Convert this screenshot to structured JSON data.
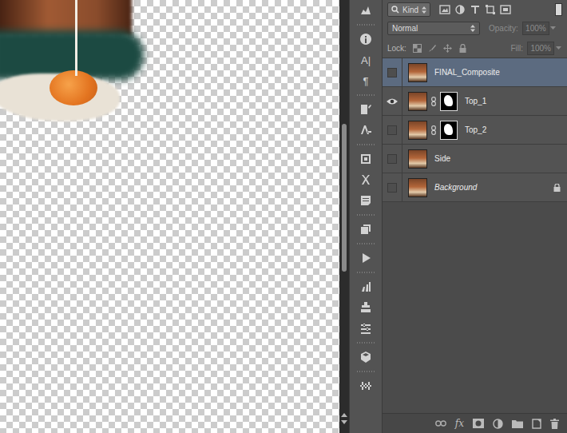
{
  "filter": {
    "kind": "Kind"
  },
  "blend": {
    "mode": "Normal",
    "opacity_label": "Opacity:",
    "opacity": "100%",
    "opacity_disabled": true
  },
  "lock": {
    "label": "Lock:",
    "fill_label": "Fill:",
    "fill": "100%",
    "fill_disabled": true
  },
  "tools": [
    {
      "kind": "icon",
      "glyph": ""
    },
    {
      "kind": "grip",
      "glyph": ""
    },
    {
      "kind": "icon",
      "glyph": ""
    },
    {
      "kind": "glyph",
      "glyph": "A|"
    },
    {
      "kind": "glyph",
      "glyph": "¶"
    },
    {
      "kind": "grip",
      "glyph": ""
    },
    {
      "kind": "icon",
      "glyph": ""
    },
    {
      "kind": "icon",
      "glyph": ""
    },
    {
      "kind": "grip",
      "glyph": ""
    },
    {
      "kind": "icon",
      "glyph": ""
    },
    {
      "kind": "icon",
      "glyph": ""
    },
    {
      "kind": "icon",
      "glyph": ""
    },
    {
      "kind": "grip",
      "glyph": ""
    },
    {
      "kind": "icon",
      "glyph": ""
    },
    {
      "kind": "grip",
      "glyph": ""
    },
    {
      "kind": "icon",
      "glyph": ""
    },
    {
      "kind": "grip",
      "glyph": ""
    },
    {
      "kind": "icon",
      "glyph": ""
    },
    {
      "kind": "icon",
      "glyph": ""
    },
    {
      "kind": "icon",
      "glyph": ""
    },
    {
      "kind": "grip",
      "glyph": ""
    },
    {
      "kind": "icon",
      "glyph": ""
    },
    {
      "kind": "grip",
      "glyph": ""
    },
    {
      "kind": "icon",
      "glyph": ""
    }
  ],
  "layers": [
    {
      "name": "FINAL_Composite",
      "visible": false,
      "selected": true,
      "mask": false,
      "locked": false,
      "italic": false
    },
    {
      "name": "Top_1",
      "visible": true,
      "selected": false,
      "mask": true,
      "locked": false,
      "italic": false
    },
    {
      "name": "Top_2",
      "visible": false,
      "selected": false,
      "mask": true,
      "locked": false,
      "italic": false
    },
    {
      "name": "Side",
      "visible": false,
      "selected": false,
      "mask": false,
      "locked": false,
      "italic": false
    },
    {
      "name": "Background",
      "visible": false,
      "selected": false,
      "mask": false,
      "locked": true,
      "italic": true
    }
  ],
  "bottom_bar": {
    "effects_label": "fx"
  }
}
